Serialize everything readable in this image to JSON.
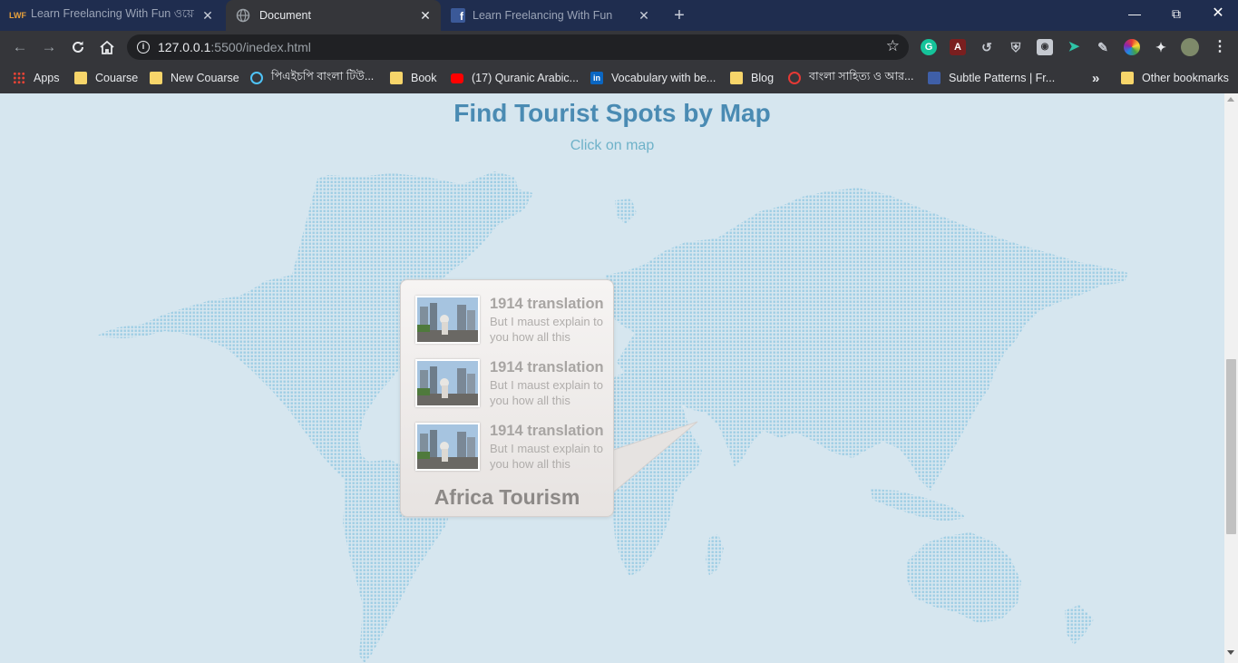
{
  "browser": {
    "tabs": [
      {
        "title": "Learn Freelancing With Fun ওয়েব",
        "active": false
      },
      {
        "title": "Document",
        "active": true
      },
      {
        "title": "Learn Freelancing With Fun",
        "active": false
      }
    ],
    "tab_close": "✕",
    "new_tab": "+",
    "url_host": "127.0.0.1",
    "url_rest": ":5500/inedex.html",
    "info_glyph": "i",
    "bookmarks": [
      {
        "label": "Apps",
        "icon": "apps-grid-icon"
      },
      {
        "label": "Couarse",
        "icon": "folder-icon"
      },
      {
        "label": "New Couarse",
        "icon": "folder-icon"
      },
      {
        "label": "পিএইচপি বাংলা টিউ...",
        "icon": "globe-icon"
      },
      {
        "label": "Book",
        "icon": "folder-icon"
      },
      {
        "label": "(17) Quranic Arabic...",
        "icon": "youtube-icon"
      },
      {
        "label": "Vocabulary with be...",
        "icon": "linkedin-icon"
      },
      {
        "label": "Blog",
        "icon": "folder-icon"
      },
      {
        "label": "বাংলা সাহিত্য ও আর...",
        "icon": "site-icon"
      },
      {
        "label": "Subtle Patterns | Fr...",
        "icon": "pattern-icon"
      }
    ],
    "bookmarks_more": "»",
    "other_bookmarks": "Other bookmarks",
    "colors": {
      "frame": "#1f2d4f",
      "toolbar": "#35363a",
      "omnibox": "#202124"
    }
  },
  "page": {
    "title": "Find Tourist Spots by Map",
    "subtitle": "Click on map",
    "popup": {
      "items": [
        {
          "title": "1914 translation",
          "desc": "But I maust explain to you how all this"
        },
        {
          "title": "1914 translation",
          "desc": "But I maust explain to you how all this"
        },
        {
          "title": "1914 translation",
          "desc": "But I maust explain to you how all this"
        }
      ],
      "region": "Africa Tourism"
    },
    "colors": {
      "background": "#d6e6ef",
      "map_dots": "#9ecde4",
      "title": "#4a8bb3",
      "subtitle": "#6fb2c9"
    }
  }
}
